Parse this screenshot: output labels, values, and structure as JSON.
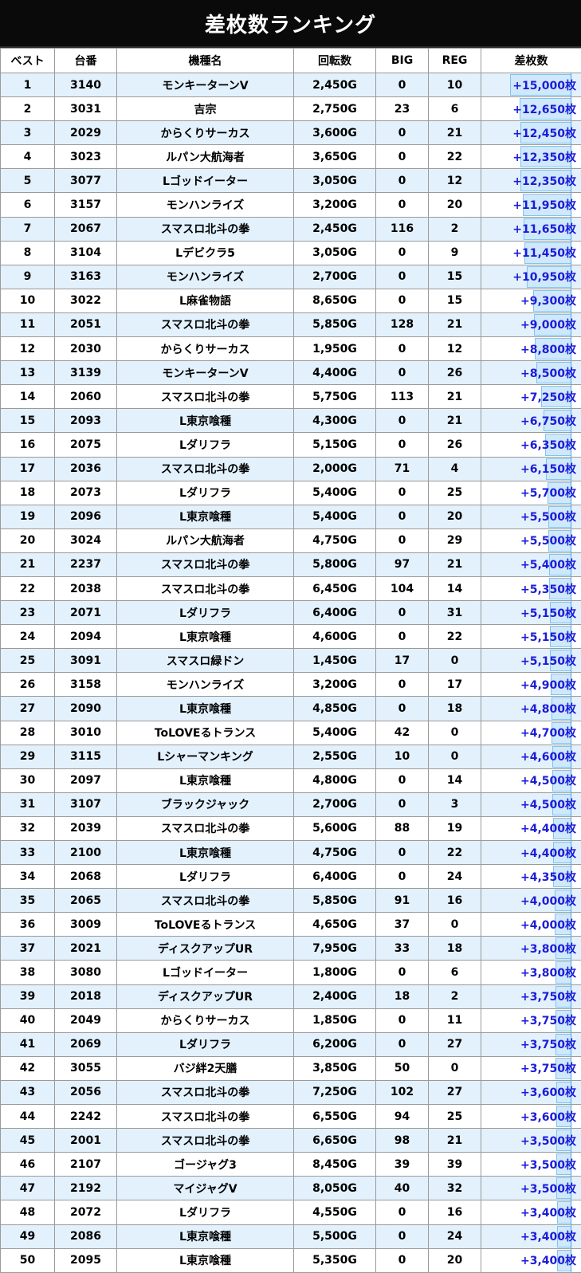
{
  "title": "差枚数ランキング",
  "columns": [
    "ベスト",
    "台番",
    "機種名",
    "回転数",
    "BIG",
    "REG",
    "差枚数"
  ],
  "max_diff": 15000,
  "rows": [
    {
      "rank": "1",
      "machine": "3140",
      "name": "モンキーターンV",
      "spins": "2,450G",
      "big": "0",
      "reg": "10",
      "diff": "+15,000枚",
      "value": 15000
    },
    {
      "rank": "2",
      "machine": "3031",
      "name": "吉宗",
      "spins": "2,750G",
      "big": "23",
      "reg": "6",
      "diff": "+12,650枚",
      "value": 12650
    },
    {
      "rank": "3",
      "machine": "2029",
      "name": "からくりサーカス",
      "spins": "3,600G",
      "big": "0",
      "reg": "21",
      "diff": "+12,450枚",
      "value": 12450
    },
    {
      "rank": "4",
      "machine": "3023",
      "name": "ルパン大航海者",
      "spins": "3,650G",
      "big": "0",
      "reg": "22",
      "diff": "+12,350枚",
      "value": 12350
    },
    {
      "rank": "5",
      "machine": "3077",
      "name": "Lゴッドイーター",
      "spins": "3,050G",
      "big": "0",
      "reg": "12",
      "diff": "+12,350枚",
      "value": 12350
    },
    {
      "rank": "6",
      "machine": "3157",
      "name": "モンハンライズ",
      "spins": "3,200G",
      "big": "0",
      "reg": "20",
      "diff": "+11,950枚",
      "value": 11950
    },
    {
      "rank": "7",
      "machine": "2067",
      "name": "スマスロ北斗の拳",
      "spins": "2,450G",
      "big": "116",
      "reg": "2",
      "diff": "+11,650枚",
      "value": 11650
    },
    {
      "rank": "8",
      "machine": "3104",
      "name": "Lデビクラ5",
      "spins": "3,050G",
      "big": "0",
      "reg": "9",
      "diff": "+11,450枚",
      "value": 11450
    },
    {
      "rank": "9",
      "machine": "3163",
      "name": "モンハンライズ",
      "spins": "2,700G",
      "big": "0",
      "reg": "15",
      "diff": "+10,950枚",
      "value": 10950
    },
    {
      "rank": "10",
      "machine": "3022",
      "name": "L麻雀物語",
      "spins": "8,650G",
      "big": "0",
      "reg": "15",
      "diff": "+9,300枚",
      "value": 9300
    },
    {
      "rank": "11",
      "machine": "2051",
      "name": "スマスロ北斗の拳",
      "spins": "5,850G",
      "big": "128",
      "reg": "21",
      "diff": "+9,000枚",
      "value": 9000
    },
    {
      "rank": "12",
      "machine": "2030",
      "name": "からくりサーカス",
      "spins": "1,950G",
      "big": "0",
      "reg": "12",
      "diff": "+8,800枚",
      "value": 8800
    },
    {
      "rank": "13",
      "machine": "3139",
      "name": "モンキーターンV",
      "spins": "4,400G",
      "big": "0",
      "reg": "26",
      "diff": "+8,500枚",
      "value": 8500
    },
    {
      "rank": "14",
      "machine": "2060",
      "name": "スマスロ北斗の拳",
      "spins": "5,750G",
      "big": "113",
      "reg": "21",
      "diff": "+7,250枚",
      "value": 7250
    },
    {
      "rank": "15",
      "machine": "2093",
      "name": "L東京喰種",
      "spins": "4,300G",
      "big": "0",
      "reg": "21",
      "diff": "+6,750枚",
      "value": 6750
    },
    {
      "rank": "16",
      "machine": "2075",
      "name": "Lダリフラ",
      "spins": "5,150G",
      "big": "0",
      "reg": "26",
      "diff": "+6,350枚",
      "value": 6350
    },
    {
      "rank": "17",
      "machine": "2036",
      "name": "スマスロ北斗の拳",
      "spins": "2,000G",
      "big": "71",
      "reg": "4",
      "diff": "+6,150枚",
      "value": 6150
    },
    {
      "rank": "18",
      "machine": "2073",
      "name": "Lダリフラ",
      "spins": "5,400G",
      "big": "0",
      "reg": "25",
      "diff": "+5,700枚",
      "value": 5700
    },
    {
      "rank": "19",
      "machine": "2096",
      "name": "L東京喰種",
      "spins": "5,400G",
      "big": "0",
      "reg": "20",
      "diff": "+5,500枚",
      "value": 5500
    },
    {
      "rank": "20",
      "machine": "3024",
      "name": "ルパン大航海者",
      "spins": "4,750G",
      "big": "0",
      "reg": "29",
      "diff": "+5,500枚",
      "value": 5500
    },
    {
      "rank": "21",
      "machine": "2237",
      "name": "スマスロ北斗の拳",
      "spins": "5,800G",
      "big": "97",
      "reg": "21",
      "diff": "+5,400枚",
      "value": 5400
    },
    {
      "rank": "22",
      "machine": "2038",
      "name": "スマスロ北斗の拳",
      "spins": "6,450G",
      "big": "104",
      "reg": "14",
      "diff": "+5,350枚",
      "value": 5350
    },
    {
      "rank": "23",
      "machine": "2071",
      "name": "Lダリフラ",
      "spins": "6,400G",
      "big": "0",
      "reg": "31",
      "diff": "+5,150枚",
      "value": 5150
    },
    {
      "rank": "24",
      "machine": "2094",
      "name": "L東京喰種",
      "spins": "4,600G",
      "big": "0",
      "reg": "22",
      "diff": "+5,150枚",
      "value": 5150
    },
    {
      "rank": "25",
      "machine": "3091",
      "name": "スマスロ緑ドン",
      "spins": "1,450G",
      "big": "17",
      "reg": "0",
      "diff": "+5,150枚",
      "value": 5150
    },
    {
      "rank": "26",
      "machine": "3158",
      "name": "モンハンライズ",
      "spins": "3,200G",
      "big": "0",
      "reg": "17",
      "diff": "+4,900枚",
      "value": 4900
    },
    {
      "rank": "27",
      "machine": "2090",
      "name": "L東京喰種",
      "spins": "4,850G",
      "big": "0",
      "reg": "18",
      "diff": "+4,800枚",
      "value": 4800
    },
    {
      "rank": "28",
      "machine": "3010",
      "name": "ToLOVEるトランス",
      "spins": "5,400G",
      "big": "42",
      "reg": "0",
      "diff": "+4,700枚",
      "value": 4700
    },
    {
      "rank": "29",
      "machine": "3115",
      "name": "Lシャーマンキング",
      "spins": "2,550G",
      "big": "10",
      "reg": "0",
      "diff": "+4,600枚",
      "value": 4600
    },
    {
      "rank": "30",
      "machine": "2097",
      "name": "L東京喰種",
      "spins": "4,800G",
      "big": "0",
      "reg": "14",
      "diff": "+4,500枚",
      "value": 4500
    },
    {
      "rank": "31",
      "machine": "3107",
      "name": "ブラックジャック",
      "spins": "2,700G",
      "big": "0",
      "reg": "3",
      "diff": "+4,500枚",
      "value": 4500
    },
    {
      "rank": "32",
      "machine": "2039",
      "name": "スマスロ北斗の拳",
      "spins": "5,600G",
      "big": "88",
      "reg": "19",
      "diff": "+4,400枚",
      "value": 4400
    },
    {
      "rank": "33",
      "machine": "2100",
      "name": "L東京喰種",
      "spins": "4,750G",
      "big": "0",
      "reg": "22",
      "diff": "+4,400枚",
      "value": 4400
    },
    {
      "rank": "34",
      "machine": "2068",
      "name": "Lダリフラ",
      "spins": "6,400G",
      "big": "0",
      "reg": "24",
      "diff": "+4,350枚",
      "value": 4350
    },
    {
      "rank": "35",
      "machine": "2065",
      "name": "スマスロ北斗の拳",
      "spins": "5,850G",
      "big": "91",
      "reg": "16",
      "diff": "+4,000枚",
      "value": 4000
    },
    {
      "rank": "36",
      "machine": "3009",
      "name": "ToLOVEるトランス",
      "spins": "4,650G",
      "big": "37",
      "reg": "0",
      "diff": "+4,000枚",
      "value": 4000
    },
    {
      "rank": "37",
      "machine": "2021",
      "name": "ディスクアップUR",
      "spins": "7,950G",
      "big": "33",
      "reg": "18",
      "diff": "+3,800枚",
      "value": 3800
    },
    {
      "rank": "38",
      "machine": "3080",
      "name": "Lゴッドイーター",
      "spins": "1,800G",
      "big": "0",
      "reg": "6",
      "diff": "+3,800枚",
      "value": 3800
    },
    {
      "rank": "39",
      "machine": "2018",
      "name": "ディスクアップUR",
      "spins": "2,400G",
      "big": "18",
      "reg": "2",
      "diff": "+3,750枚",
      "value": 3750
    },
    {
      "rank": "40",
      "machine": "2049",
      "name": "からくりサーカス",
      "spins": "1,850G",
      "big": "0",
      "reg": "11",
      "diff": "+3,750枚",
      "value": 3750
    },
    {
      "rank": "41",
      "machine": "2069",
      "name": "Lダリフラ",
      "spins": "6,200G",
      "big": "0",
      "reg": "27",
      "diff": "+3,750枚",
      "value": 3750
    },
    {
      "rank": "42",
      "machine": "3055",
      "name": "バジ絆2天膳",
      "spins": "3,850G",
      "big": "50",
      "reg": "0",
      "diff": "+3,750枚",
      "value": 3750
    },
    {
      "rank": "43",
      "machine": "2056",
      "name": "スマスロ北斗の拳",
      "spins": "7,250G",
      "big": "102",
      "reg": "27",
      "diff": "+3,600枚",
      "value": 3600
    },
    {
      "rank": "44",
      "machine": "2242",
      "name": "スマスロ北斗の拳",
      "spins": "6,550G",
      "big": "94",
      "reg": "25",
      "diff": "+3,600枚",
      "value": 3600
    },
    {
      "rank": "45",
      "machine": "2001",
      "name": "スマスロ北斗の拳",
      "spins": "6,650G",
      "big": "98",
      "reg": "21",
      "diff": "+3,500枚",
      "value": 3500
    },
    {
      "rank": "46",
      "machine": "2107",
      "name": "ゴージャグ3",
      "spins": "8,450G",
      "big": "39",
      "reg": "39",
      "diff": "+3,500枚",
      "value": 3500
    },
    {
      "rank": "47",
      "machine": "2192",
      "name": "マイジャグV",
      "spins": "8,050G",
      "big": "40",
      "reg": "32",
      "diff": "+3,500枚",
      "value": 3500
    },
    {
      "rank": "48",
      "machine": "2072",
      "name": "Lダリフラ",
      "spins": "4,550G",
      "big": "0",
      "reg": "16",
      "diff": "+3,400枚",
      "value": 3400
    },
    {
      "rank": "49",
      "machine": "2086",
      "name": "L東京喰種",
      "spins": "5,500G",
      "big": "0",
      "reg": "24",
      "diff": "+3,400枚",
      "value": 3400
    },
    {
      "rank": "50",
      "machine": "2095",
      "name": "L東京喰種",
      "spins": "5,350G",
      "big": "0",
      "reg": "20",
      "diff": "+3,400枚",
      "value": 3400
    }
  ]
}
